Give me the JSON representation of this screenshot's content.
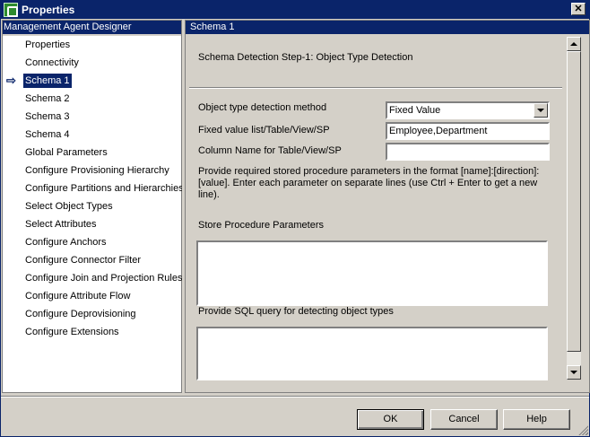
{
  "window": {
    "title": "Properties",
    "close_label": "✕"
  },
  "sidebar": {
    "header": "Management Agent Designer",
    "selected_index": 2,
    "items": [
      {
        "label": "Properties"
      },
      {
        "label": "Connectivity"
      },
      {
        "label": "Schema 1"
      },
      {
        "label": "Schema 2"
      },
      {
        "label": "Schema 3"
      },
      {
        "label": "Schema 4"
      },
      {
        "label": "Global Parameters"
      },
      {
        "label": "Configure Provisioning Hierarchy"
      },
      {
        "label": "Configure Partitions and Hierarchies"
      },
      {
        "label": "Select Object Types"
      },
      {
        "label": "Select Attributes"
      },
      {
        "label": "Configure Anchors"
      },
      {
        "label": "Configure Connector Filter"
      },
      {
        "label": "Configure Join and Projection Rules"
      },
      {
        "label": "Configure Attribute Flow"
      },
      {
        "label": "Configure Deprovisioning"
      },
      {
        "label": "Configure Extensions"
      }
    ]
  },
  "main": {
    "header": "Schema 1",
    "step_title": "Schema Detection Step-1: Object Type Detection",
    "detection_method": {
      "label": "Object type detection method",
      "value": "Fixed Value"
    },
    "fixed_value_list": {
      "label": "Fixed value list/Table/View/SP",
      "value": "Employee,Department"
    },
    "column_name": {
      "label": "Column Name for Table/View/SP",
      "value": ""
    },
    "help_text": "Provide required stored procedure parameters in the format [name]:[direction]:[value]. Enter each parameter on separate lines (use Ctrl + Enter to get a new line).",
    "sp_params": {
      "label": "Store Procedure Parameters",
      "value": ""
    },
    "sql_query": {
      "label": "Provide SQL query for detecting object types",
      "value": ""
    }
  },
  "buttons": {
    "ok": "OK",
    "cancel": "Cancel",
    "help": "Help"
  }
}
